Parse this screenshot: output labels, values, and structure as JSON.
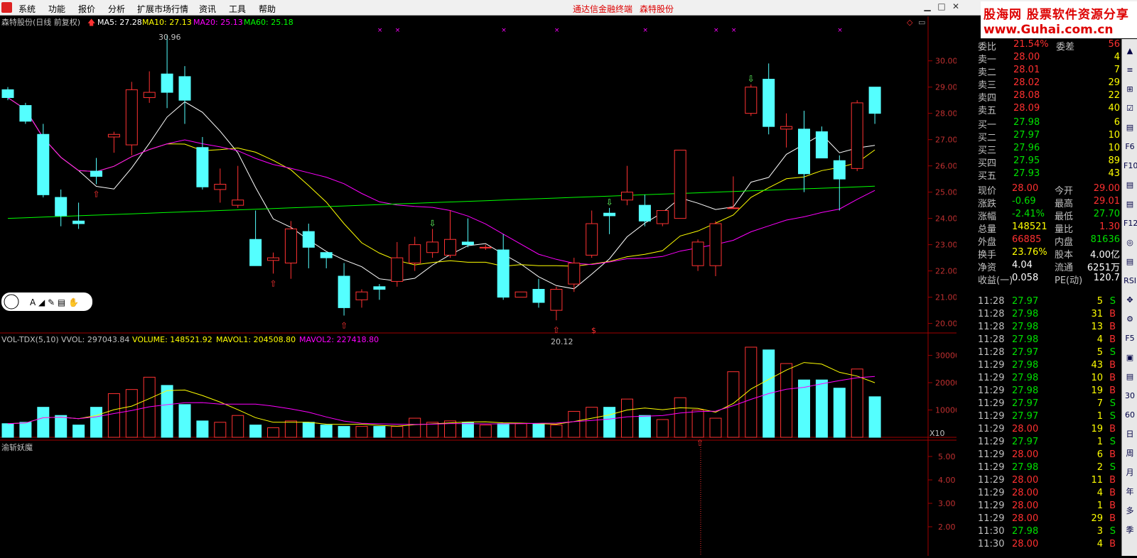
{
  "menu": {
    "items": [
      "系统",
      "功能",
      "报价",
      "分析",
      "扩展市场行情",
      "资讯",
      "工具",
      "帮助"
    ],
    "center_title": "通达信金融终端",
    "center_stock": "森特股份"
  },
  "brand": {
    "line1": "股海网 股票软件资源分享",
    "line2": "www.Guhai.com.cn"
  },
  "chart": {
    "stock_label": "森特股份(日线 前复权)",
    "ma_labels": [
      {
        "text": "MA5: 27.28",
        "color": "#ffffff"
      },
      {
        "text": "MA10: 27.13",
        "color": "#ffff00"
      },
      {
        "text": "MA20: 25.13",
        "color": "#ff00ff"
      },
      {
        "text": "MA60: 25.18",
        "color": "#00ff00"
      }
    ],
    "price_ticks": [
      "30.00",
      "29.00",
      "28.00",
      "27.00",
      "26.00",
      "25.00",
      "24.00",
      "23.00",
      "22.00",
      "21.00",
      "20.00"
    ],
    "high_marker": "30.96",
    "low_marker": "20.12",
    "dollar_marker": "$",
    "vol_label": "VOL-TDX(5,10)",
    "vol_values": [
      {
        "text": "VVOL: 297043.84",
        "color": "#c0c0c0"
      },
      {
        "text": "VOLUME: 148521.92",
        "color": "#ffff00"
      },
      {
        "text": "MAVOL1: 204508.80",
        "color": "#ffff00"
      },
      {
        "text": "MAVOL2: 227418.80",
        "color": "#ff00ff"
      }
    ],
    "vol_ticks": [
      "30000",
      "20000",
      "10000"
    ],
    "vol_unit": "X10",
    "ind_label": "渝斩妖魔",
    "ind_ticks": [
      "5.00",
      "4.00",
      "3.00",
      "2.00"
    ],
    "toolbar_glyphs": "A ◢ ✎ ▤ ✋"
  },
  "chart_data": {
    "type": "candlestick",
    "candles": [
      [
        28.9,
        29.0,
        28.5,
        28.6
      ],
      [
        28.3,
        28.4,
        27.6,
        27.7
      ],
      [
        27.2,
        27.6,
        24.8,
        24.9
      ],
      [
        24.8,
        25.1,
        23.7,
        24.1
      ],
      [
        23.9,
        24.6,
        23.6,
        23.8
      ],
      [
        25.8,
        26.3,
        25.3,
        25.6
      ],
      [
        27.1,
        27.3,
        26.5,
        27.2
      ],
      [
        26.8,
        29.2,
        26.4,
        28.9
      ],
      [
        28.6,
        29.6,
        28.4,
        28.8
      ],
      [
        29.5,
        30.96,
        28.2,
        28.8
      ],
      [
        29.4,
        29.8,
        27.6,
        28.5
      ],
      [
        26.7,
        27.1,
        25.1,
        25.2
      ],
      [
        25.1,
        25.9,
        24.6,
        25.3
      ],
      [
        24.5,
        26.0,
        24.4,
        24.7
      ],
      [
        23.2,
        24.3,
        22.2,
        22.2
      ],
      [
        22.4,
        22.7,
        21.9,
        22.5
      ],
      [
        22.3,
        23.9,
        21.7,
        23.6
      ],
      [
        23.5,
        23.8,
        22.1,
        22.9
      ],
      [
        22.7,
        22.7,
        22.1,
        22.5
      ],
      [
        21.8,
        22.3,
        20.3,
        20.6
      ],
      [
        20.9,
        21.3,
        20.6,
        21.2
      ],
      [
        21.4,
        21.5,
        20.9,
        21.3
      ],
      [
        21.6,
        23.1,
        21.4,
        22.5
      ],
      [
        22.3,
        23.3,
        22.0,
        23.0
      ],
      [
        22.7,
        23.6,
        22.5,
        23.1
      ],
      [
        22.6,
        24.3,
        22.5,
        23.2
      ],
      [
        23.1,
        24.0,
        22.9,
        23.0
      ],
      [
        22.9,
        23.0,
        22.8,
        22.9
      ],
      [
        22.8,
        23.4,
        20.9,
        21.0
      ],
      [
        21.0,
        21.2,
        21.0,
        21.2
      ],
      [
        21.3,
        21.7,
        20.6,
        20.8
      ],
      [
        20.5,
        21.4,
        20.12,
        21.3
      ],
      [
        21.5,
        22.5,
        21.2,
        22.3
      ],
      [
        22.6,
        24.3,
        22.5,
        23.8
      ],
      [
        24.2,
        24.4,
        23.4,
        24.1
      ],
      [
        24.7,
        26.0,
        24.5,
        25.0
      ],
      [
        24.5,
        24.9,
        23.7,
        23.9
      ],
      [
        23.8,
        24.3,
        23.7,
        24.3
      ],
      [
        24.0,
        26.6,
        24.0,
        26.6
      ],
      [
        22.2,
        23.2,
        22.0,
        23.1
      ],
      [
        22.2,
        23.9,
        21.8,
        23.8
      ],
      [
        24.4,
        25.6,
        24.4,
        24.4
      ],
      [
        28.0,
        29.1,
        27.9,
        29.0
      ],
      [
        29.3,
        29.9,
        27.2,
        27.5
      ],
      [
        27.4,
        28.0,
        26.7,
        27.5
      ],
      [
        27.4,
        28.1,
        25.0,
        25.7
      ],
      [
        27.3,
        27.5,
        26.3,
        26.3
      ],
      [
        26.2,
        26.4,
        24.3,
        25.5
      ],
      [
        25.9,
        28.5,
        25.8,
        28.4
      ],
      [
        29.0,
        29.0,
        27.6,
        28.0
      ]
    ],
    "volumes": [
      5000,
      5500,
      11000,
      8000,
      4500,
      11000,
      16000,
      17500,
      22000,
      19000,
      12000,
      6000,
      5500,
      8000,
      4500,
      3500,
      6000,
      5500,
      4500,
      4000,
      4000,
      4000,
      4000,
      7000,
      5500,
      6000,
      5500,
      4500,
      5000,
      5000,
      5000,
      4500,
      9500,
      11000,
      11000,
      14000,
      8000,
      6500,
      14500,
      10000,
      7000,
      24000,
      33000,
      32000,
      27000,
      21000,
      21000,
      18000,
      25000,
      14852
    ],
    "ma_series": [
      "MA5",
      "MA10",
      "MA20",
      "MA60"
    ],
    "price_range": [
      19.8,
      31.1
    ],
    "volume_range": [
      0,
      33000
    ]
  },
  "quote": {
    "order_ratio": {
      "label": "委比",
      "value": "21.54%",
      "label2": "委差",
      "value2": "56"
    },
    "sell": [
      {
        "label": "卖五",
        "price": "28.09",
        "vol": "40"
      },
      {
        "label": "卖四",
        "price": "28.08",
        "vol": "22"
      },
      {
        "label": "卖三",
        "price": "28.02",
        "vol": "29"
      },
      {
        "label": "卖二",
        "price": "28.01",
        "vol": "7"
      },
      {
        "label": "卖一",
        "price": "28.00",
        "vol": "4"
      }
    ],
    "buy": [
      {
        "label": "买一",
        "price": "27.98",
        "vol": "6"
      },
      {
        "label": "买二",
        "price": "27.97",
        "vol": "10"
      },
      {
        "label": "买三",
        "price": "27.96",
        "vol": "10"
      },
      {
        "label": "买四",
        "price": "27.95",
        "vol": "89"
      },
      {
        "label": "买五",
        "price": "27.93",
        "vol": "43"
      }
    ],
    "stats": [
      {
        "l1": "现价",
        "v1": "28.00",
        "c1": "#ff3030",
        "l2": "今开",
        "v2": "29.00",
        "c2": "#ff3030"
      },
      {
        "l1": "涨跌",
        "v1": "-0.69",
        "c1": "#00e000",
        "l2": "最高",
        "v2": "29.01",
        "c2": "#ff3030"
      },
      {
        "l1": "涨幅",
        "v1": "-2.41%",
        "c1": "#00e000",
        "l2": "最低",
        "v2": "27.70",
        "c2": "#00e000"
      },
      {
        "l1": "总量",
        "v1": "148521",
        "c1": "#ffff00",
        "l2": "量比",
        "v2": "1.30",
        "c2": "#ff3030"
      },
      {
        "l1": "外盘",
        "v1": "66885",
        "c1": "#ff3030",
        "l2": "内盘",
        "v2": "81636",
        "c2": "#00e000"
      },
      {
        "l1": "换手",
        "v1": "23.76%",
        "c1": "#ffff00",
        "l2": "股本",
        "v2": "4.00亿",
        "c2": "#ffffff"
      },
      {
        "l1": "净资",
        "v1": "4.04",
        "c1": "#ffffff",
        "l2": "流通",
        "v2": "6251万",
        "c2": "#ffffff"
      },
      {
        "l1": "收益(一)",
        "v1": "0.058",
        "c1": "#ffffff",
        "l2": "PE(动)",
        "v2": "120.7",
        "c2": "#ffffff"
      }
    ],
    "ticks": [
      {
        "t": "11:28",
        "p": "27.97",
        "v": "5",
        "s": "S"
      },
      {
        "t": "11:28",
        "p": "27.98",
        "v": "31",
        "s": "B"
      },
      {
        "t": "11:28",
        "p": "27.98",
        "v": "13",
        "s": "B"
      },
      {
        "t": "11:28",
        "p": "27.98",
        "v": "4",
        "s": "B"
      },
      {
        "t": "11:28",
        "p": "27.97",
        "v": "5",
        "s": "S"
      },
      {
        "t": "11:29",
        "p": "27.98",
        "v": "43",
        "s": "B"
      },
      {
        "t": "11:29",
        "p": "27.98",
        "v": "10",
        "s": "B"
      },
      {
        "t": "11:29",
        "p": "27.98",
        "v": "19",
        "s": "B"
      },
      {
        "t": "11:29",
        "p": "27.97",
        "v": "7",
        "s": "S"
      },
      {
        "t": "11:29",
        "p": "27.97",
        "v": "1",
        "s": "S"
      },
      {
        "t": "11:29",
        "p": "28.00",
        "v": "19",
        "s": "B"
      },
      {
        "t": "11:29",
        "p": "27.97",
        "v": "1",
        "s": "S"
      },
      {
        "t": "11:29",
        "p": "28.00",
        "v": "6",
        "s": "B"
      },
      {
        "t": "11:29",
        "p": "27.98",
        "v": "2",
        "s": "S"
      },
      {
        "t": "11:29",
        "p": "28.00",
        "v": "11",
        "s": "B"
      },
      {
        "t": "11:29",
        "p": "28.00",
        "v": "4",
        "s": "B"
      },
      {
        "t": "11:29",
        "p": "28.00",
        "v": "1",
        "s": "B"
      },
      {
        "t": "11:29",
        "p": "28.00",
        "v": "29",
        "s": "B"
      },
      {
        "t": "11:30",
        "p": "27.98",
        "v": "3",
        "s": "S"
      },
      {
        "t": "11:30",
        "p": "28.00",
        "v": "4",
        "s": "B"
      }
    ]
  },
  "sidebar": {
    "buttons": [
      "▲",
      "≡",
      "⊞",
      "☑",
      "▤",
      "F6",
      "F10",
      "▤",
      "▤",
      "F12",
      "◎",
      "▤",
      "RSI",
      "✥",
      "⚙",
      "F5",
      "▣",
      "▤",
      "30",
      "60",
      "日",
      "周",
      "月",
      "年",
      "多",
      "季"
    ]
  },
  "colors": {
    "up": "#ff3232",
    "down": "#54ffff",
    "ma5": "#ffffff",
    "ma10": "#ffff00",
    "ma20": "#ff00ff",
    "ma60": "#00ff00",
    "grid": "#a00000"
  }
}
